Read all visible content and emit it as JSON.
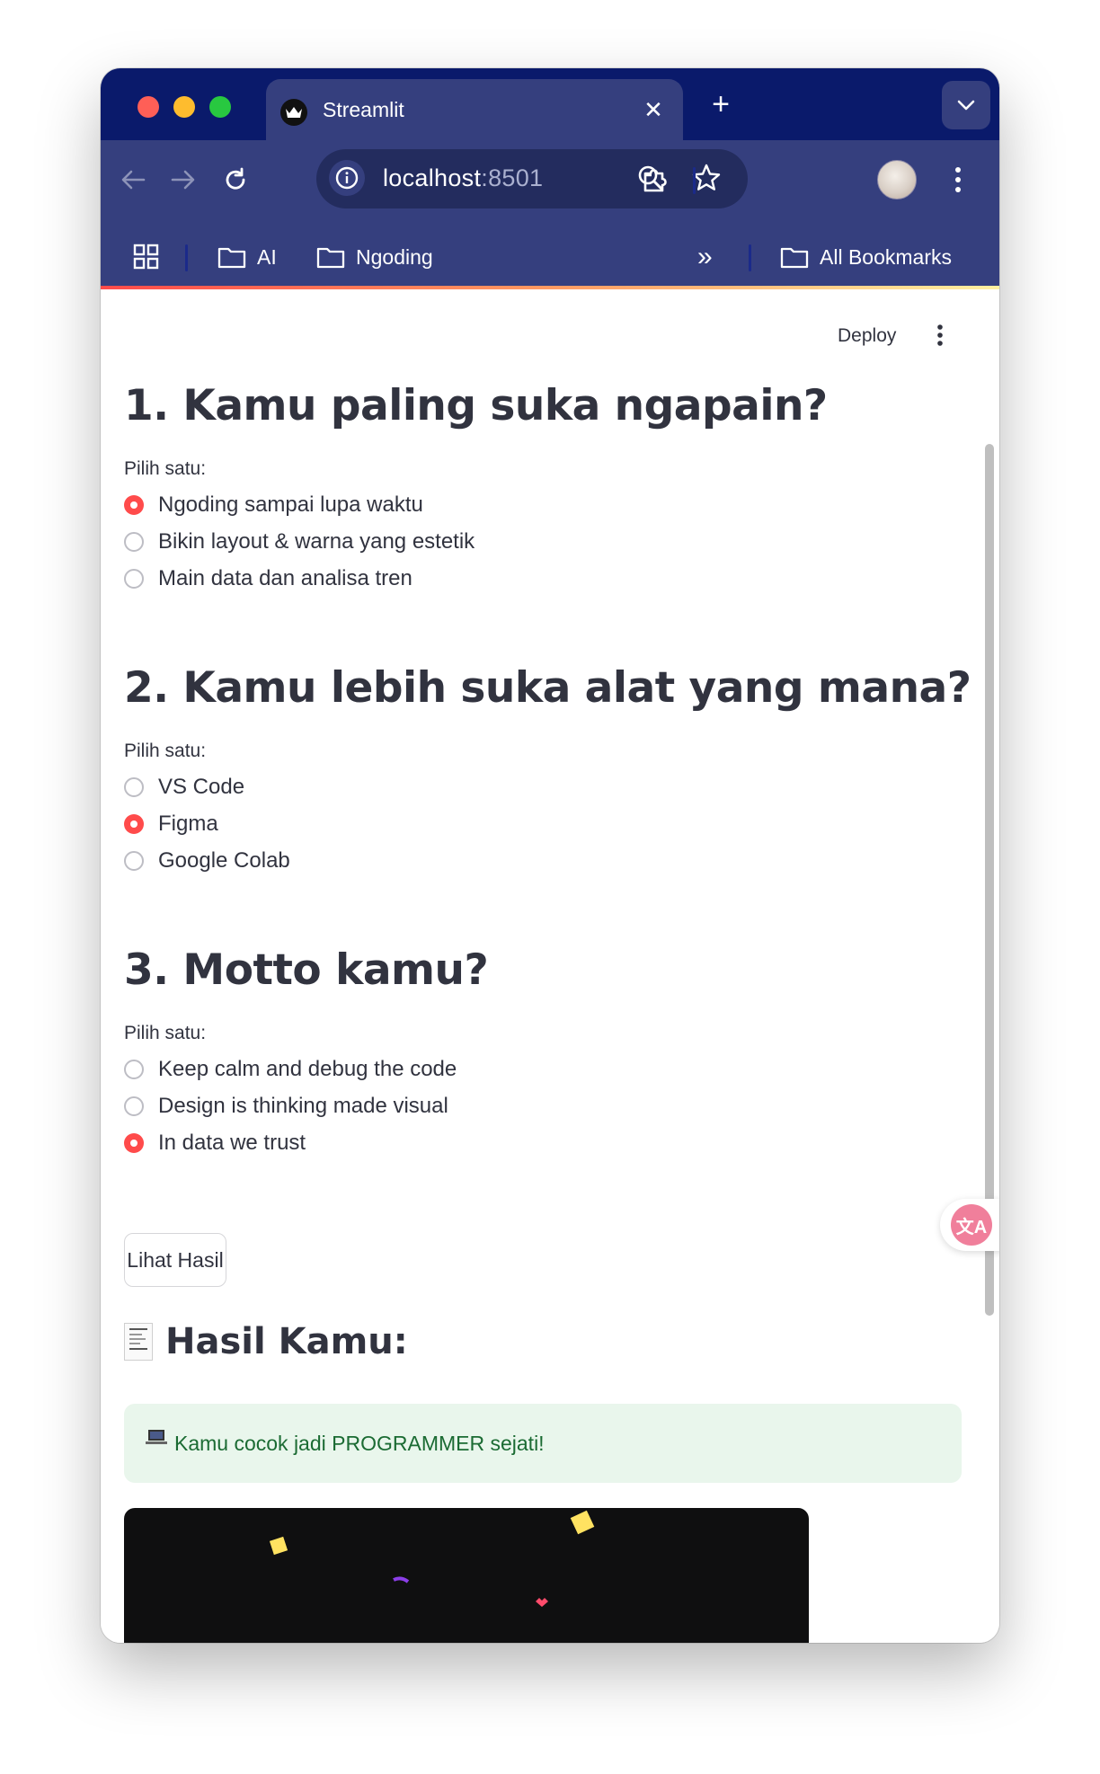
{
  "browser": {
    "tab_title": "Streamlit",
    "new_tab_symbol": "+",
    "close_symbol": "✕",
    "url_host": "localhost",
    "url_port": ":8501",
    "bookmarks": {
      "folder1": "AI",
      "folder2": "Ngoding",
      "overflow": "»",
      "all": "All Bookmarks"
    }
  },
  "app": {
    "deploy_label": "Deploy",
    "questions": [
      {
        "title": "1. Kamu paling suka ngapain?",
        "prompt": "Pilih satu:",
        "options": [
          "Ngoding sampai lupa waktu",
          "Bikin layout & warna yang estetik",
          "Main data dan analisa tren"
        ],
        "selected_index": 0
      },
      {
        "title": "2. Kamu lebih suka alat yang mana?",
        "prompt": "Pilih satu:",
        "options": [
          "VS Code",
          "Figma",
          "Google Colab"
        ],
        "selected_index": 1
      },
      {
        "title": "3. Motto kamu?",
        "prompt": "Pilih satu:",
        "options": [
          "Keep calm and debug the code",
          "Design is thinking made visual",
          "In data we trust"
        ],
        "selected_index": 2
      }
    ],
    "submit_label": "Lihat Hasil",
    "result_heading": "Hasil Kamu:",
    "result_message": "Kamu cocok jadi PROGRAMMER sejati!",
    "translate_badge": "文A"
  },
  "colors": {
    "tabbar": "#0a1a6b",
    "toolbar": "#353f7e",
    "accent": "#ff4b4b",
    "success_bg": "#e9f6ec",
    "success_text": "#1b6b33"
  },
  "icons": [
    "back-arrow-icon",
    "forward-arrow-icon",
    "reload-icon",
    "site-info-icon",
    "zoom-icon",
    "star-icon",
    "extensions-icon",
    "kebab-menu-icon",
    "apps-grid-icon",
    "folder-icon",
    "chevron-down-icon",
    "receipt-icon",
    "laptop-icon",
    "translate-icon"
  ]
}
